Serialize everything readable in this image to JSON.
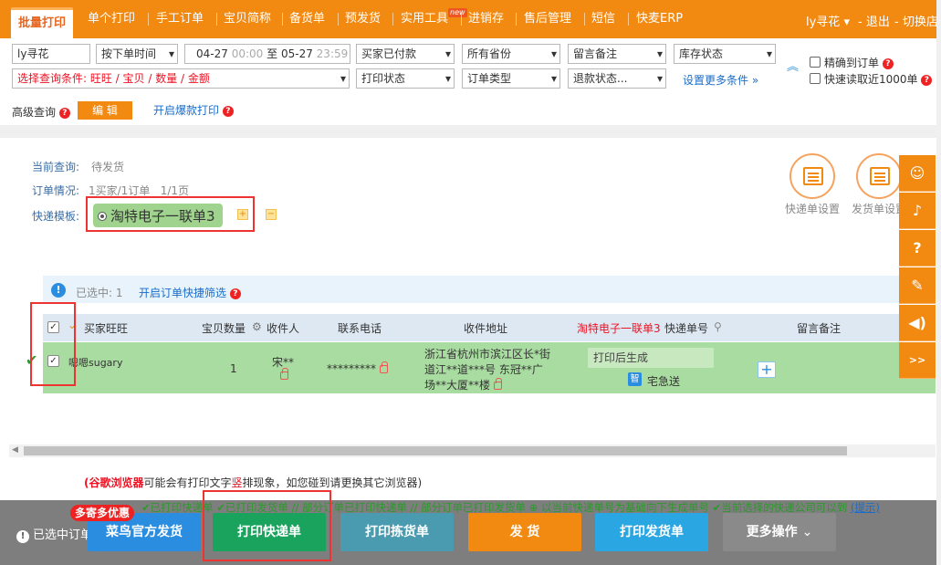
{
  "nav": {
    "tabs": [
      "批量打印",
      "单个打印",
      "手工订单",
      "宝贝简称",
      "备货单",
      "预发货",
      "实用工具",
      "进销存",
      "售后管理",
      "短信",
      "快麦ERP"
    ],
    "new_badge": "new",
    "user": "ly寻花",
    "logout": "- 退出",
    "switch_store": "- 切换店"
  },
  "filters": {
    "buyer_name": "ly寻花",
    "time_type": "按下单时间",
    "date_start": "04-27",
    "time_start": "00:00",
    "date_sep": "至",
    "date_end": "05-27",
    "time_end": "23:59",
    "pay_status": "买家已付款",
    "province": "所有省份",
    "remark": "留言备注",
    "stock": "库存状态",
    "query_condition": "选择查询条件: 旺旺 / 宝贝 / 数量 / 金额",
    "print_status": "打印状态",
    "order_type": "订单类型",
    "refund_status": "退款状态...",
    "more_conditions": "设置更多条件 »",
    "exact_order": "精确到订单",
    "fast_read": "快速读取近1000单",
    "advanced_query": "高级查询",
    "edit": "编 辑",
    "hot_print": "开启爆款打印"
  },
  "panel": {
    "current_query_label": "当前查询:",
    "current_query_value": "待发货",
    "order_status_label": "订单情况:",
    "order_status_value": "1买家/1订单   1/1页",
    "template_label": "快递模板:",
    "template_name": "淘特电子一联单3",
    "express_setting": "快递单设置",
    "ship_setting": "发货单设置"
  },
  "info": {
    "selected": "已选中: 1",
    "quick_filter": "开启订单快捷筛选"
  },
  "table": {
    "headers": {
      "buyer": "买家旺旺",
      "qty": "宝贝数量",
      "receiver": "收件人",
      "phone": "联系电话",
      "address": "收件地址",
      "template": "淘特电子一联单3",
      "tracking": "快递单号",
      "remark": "留言备注"
    },
    "rows": [
      {
        "buyer": "嗯嗯sugary",
        "qty": "1",
        "receiver": "宋**",
        "phone": "*********",
        "address_line1": "浙江省杭州市滨江区长*街",
        "address_line2": "道江**道***号 东冠**广",
        "address_line3": "场**大厦**楼",
        "tracking": "打印后生成",
        "courier_badge": "智",
        "courier": "宅急送"
      }
    ]
  },
  "bottom": {
    "browser_note_red": "(谷歌浏览器",
    "browser_note_mid": "可能会有打印文字",
    "browser_note_red2": "竖",
    "browser_note_end": "排现象，如您碰到请更换其它浏览器)",
    "legend": "✔已打印快递单 ✔已打印发货单 // 部分订单已打印快递单 // 部分订单已打印发货单 ⊕ 以当前快递单号为基础向下生成单号 ✔当前选择的快递公司可以到",
    "legend_link": "(提示)",
    "selected_orders": "已选中订单:",
    "promo": "多寄多优惠",
    "btn_cainiao": "菜鸟官方发货",
    "btn_print_express": "打印快递单",
    "btn_print_pick": "打印拣货单",
    "btn_ship": "发 货",
    "btn_print_ship": "打印发货单",
    "btn_more": "更多操作"
  }
}
